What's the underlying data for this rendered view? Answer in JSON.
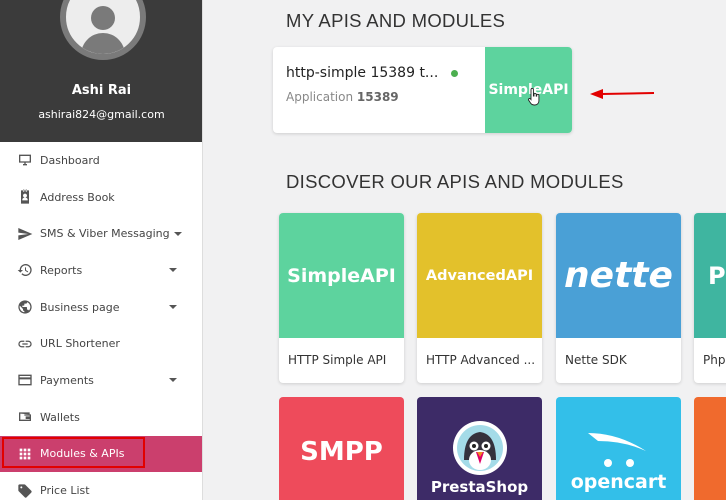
{
  "user": {
    "name": "Ashi Rai",
    "email": "ashirai824@gmail.com"
  },
  "sidebar": {
    "items": [
      {
        "label": "Dashboard",
        "icon": "monitor-icon"
      },
      {
        "label": "Address Book",
        "icon": "contact-book-icon"
      },
      {
        "label": "SMS & Viber Messaging",
        "icon": "send-icon",
        "has_caret": true
      },
      {
        "label": "Reports",
        "icon": "history-icon",
        "has_caret": true
      },
      {
        "label": "Business page",
        "icon": "globe-icon",
        "has_caret": true
      },
      {
        "label": "URL Shortener",
        "icon": "link-icon"
      },
      {
        "label": "Payments",
        "icon": "credit-card-icon",
        "has_caret": true
      },
      {
        "label": "Wallets",
        "icon": "wallet-icon"
      },
      {
        "label": "Modules & APIs",
        "icon": "grid-icon",
        "active": true
      },
      {
        "label": "Price List",
        "icon": "price-tag-icon"
      }
    ]
  },
  "main": {
    "my_section_title": "MY APIS AND MODULES",
    "my_api": {
      "title": "http-simple 15389 t...",
      "status_color": "#4caf50",
      "application_label": "Application",
      "application_id": "15389",
      "logo_text": "SimpleAPI",
      "logo_color": "#5dd39e"
    },
    "discover_section_title": "DISCOVER OUR APIS AND MODULES",
    "discover": [
      {
        "logo_text": "SimpleAPI",
        "label": "HTTP Simple API",
        "color": "#5dd39e"
      },
      {
        "logo_text": "AdvancedAPI",
        "label": "HTTP Advanced ...",
        "color": "#e3c12b"
      },
      {
        "logo_text": "nette",
        "label": "Nette SDK",
        "color": "#4aa0d6"
      },
      {
        "logo_text": "PH",
        "label": "Php",
        "color": "#3fb5a0"
      }
    ],
    "bottom_row": [
      {
        "logo_text": "SMPP",
        "color": "#ee4b5b"
      },
      {
        "logo_text": "PrestaShop",
        "color": "#3d2b67"
      },
      {
        "logo_text": "opencart",
        "color": "#33bfe9"
      },
      {
        "logo_text": "",
        "color": "#f06a2d"
      }
    ],
    "annotation_arrow_color": "#e20000"
  }
}
